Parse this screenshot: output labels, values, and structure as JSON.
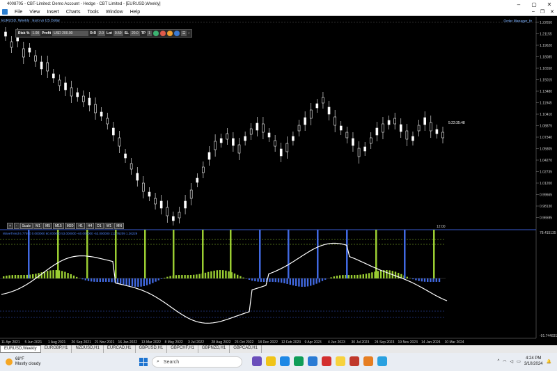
{
  "window": {
    "title": "4008705 - CBT-Limited: Demo Account - Hedge - CBT Limited - [EURUSD,Weekly]"
  },
  "menu": {
    "items": [
      "File",
      "View",
      "Insert",
      "Charts",
      "Tools",
      "Window",
      "Help"
    ]
  },
  "chart": {
    "symbol_label": "EURUSD, Weekly : Euro vs US Dollar",
    "expert_label": "Order Manager_fx",
    "countdown": "5:22:35:48",
    "current_price": "1.22650",
    "price_ticks": [
      "1.22650",
      "1.21155",
      "1.19620",
      "1.18085",
      "1.16550",
      "1.15015",
      "1.13480",
      "1.11945",
      "1.10410",
      "1.08875",
      "1.07340",
      "1.05805",
      "1.04270",
      "1.02735",
      "1.01200",
      "0.99665",
      "0.98130",
      "0.96595"
    ],
    "indicator_ticks": [
      "78.415135",
      "-91.744831"
    ],
    "indicator_label": "WaveTrend 6.77590 0.000000 60.000000 53.000000 -60.000000 -53.000000 112.76209 1.26229",
    "date_ticks": [
      "11 Apr 2021",
      "5 Jun 2021",
      "1 Aug 2021",
      "26 Sep 2021",
      "21 Nov 2021",
      "16 Jan 2022",
      "13 Mar 2022",
      "8 May 2022",
      "3 Jul 2022",
      "28 Aug 2022",
      "23 Oct 2022",
      "18 Dec 2022",
      "12 Feb 2023",
      "9 Apr 2023",
      "4 Jun 2023",
      "30 Jul 2023",
      "24 Sep 2023",
      "19 Nov 2023",
      "14 Jan 2024",
      "10 Mar 2024"
    ],
    "last_bar_label": "12:00"
  },
  "trade_toolbar": {
    "risk_label": "Risk %",
    "risk_value": "1.00",
    "profit_label": "Profit",
    "profit_value": "USD 200.00",
    "rr_label": "R:R",
    "rr_value": "2.0",
    "lot_label": "Lot",
    "lot_value": "0.50",
    "sl_label": "SL",
    "sl_value": "20.0",
    "tp_label": "TP",
    "tp_value": "1"
  },
  "timeframes": [
    "+",
    "-",
    "Scale",
    "M1",
    "M5",
    "M15",
    "M30",
    "H1",
    "H4",
    "D1",
    "W1",
    "MN"
  ],
  "tabs": [
    "EURUSD,Weekly",
    "EURGBP,H1",
    "NZDUSD,H1",
    "EURCAD,H1",
    "GBPUSD,H1",
    "GBPCHF,H1",
    "GBPNZD,H1",
    "GBPCAD,H1"
  ],
  "taskbar": {
    "weather_temp": "68°F",
    "weather_desc": "Mostly cloudy",
    "search_placeholder": "Search",
    "time": "4:24 PM",
    "date": "3/10/2024"
  },
  "colors": {
    "candle": "#ffffff",
    "wt_line": "#ffffff",
    "bar_green": "#9acd32",
    "bar_blue": "#4169e1",
    "grid_blue": "#3a5bd0"
  }
}
